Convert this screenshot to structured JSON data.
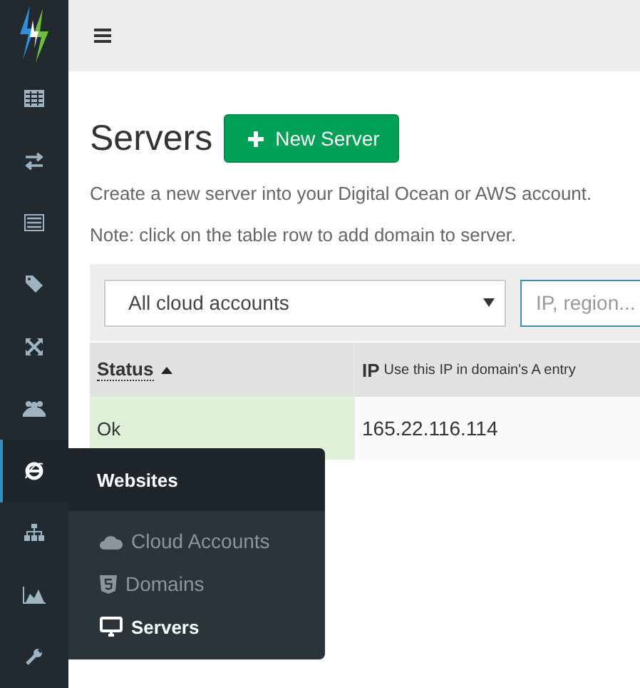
{
  "sidebar": {
    "items": [
      {
        "kind": "table",
        "selected": false
      },
      {
        "kind": "exchange",
        "selected": false
      },
      {
        "kind": "list",
        "selected": false
      },
      {
        "kind": "tag",
        "selected": false
      },
      {
        "kind": "expand",
        "selected": false
      },
      {
        "kind": "users",
        "selected": false
      },
      {
        "kind": "globe",
        "selected": true
      },
      {
        "kind": "sitemap",
        "selected": false
      },
      {
        "kind": "chart",
        "selected": false
      },
      {
        "kind": "wrench",
        "selected": false
      }
    ]
  },
  "flyout": {
    "title": "Websites",
    "items": [
      {
        "kind": "cloud",
        "label": "Cloud Accounts",
        "selected": false
      },
      {
        "kind": "html5",
        "label": "Domains",
        "selected": false
      },
      {
        "kind": "desktop",
        "label": "Servers",
        "selected": true
      }
    ]
  },
  "page": {
    "title": "Servers",
    "new_button": "New Server",
    "description": "Create a new server into your Digital Ocean or AWS account.",
    "note": "Note: click on the table row to add domain to server."
  },
  "filters": {
    "account_select": "All cloud accounts",
    "search": {
      "placeholder": "IP, region..."
    }
  },
  "table": {
    "columns": [
      {
        "label": "Status",
        "sorted": true
      },
      {
        "label": "IP",
        "hint": "Use this IP in domain's A entry",
        "sorted": false
      }
    ],
    "rows": [
      {
        "status": "Ok",
        "ip": "165.22.116.114",
        "healthy": true
      }
    ]
  }
}
